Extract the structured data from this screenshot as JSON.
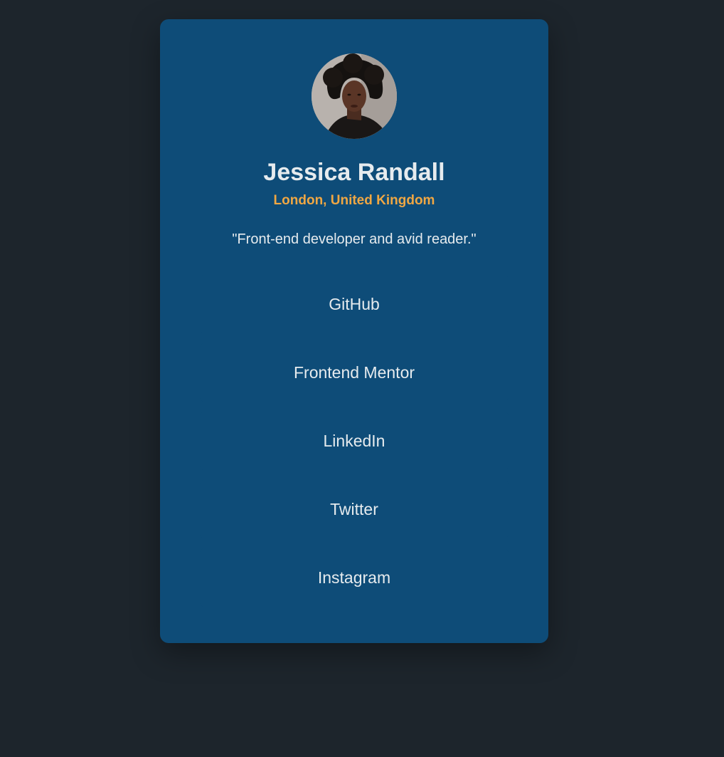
{
  "profile": {
    "name": "Jessica Randall",
    "location": "London, United Kingdom",
    "bio": "\"Front-end developer and avid reader.\""
  },
  "links": [
    {
      "label": "GitHub"
    },
    {
      "label": "Frontend Mentor"
    },
    {
      "label": "LinkedIn"
    },
    {
      "label": "Twitter"
    },
    {
      "label": "Instagram"
    }
  ],
  "colors": {
    "page_background": "#1d252c",
    "card_background": "#0e4c78",
    "location_accent": "#f0a743",
    "text_primary": "#e6ebee"
  }
}
